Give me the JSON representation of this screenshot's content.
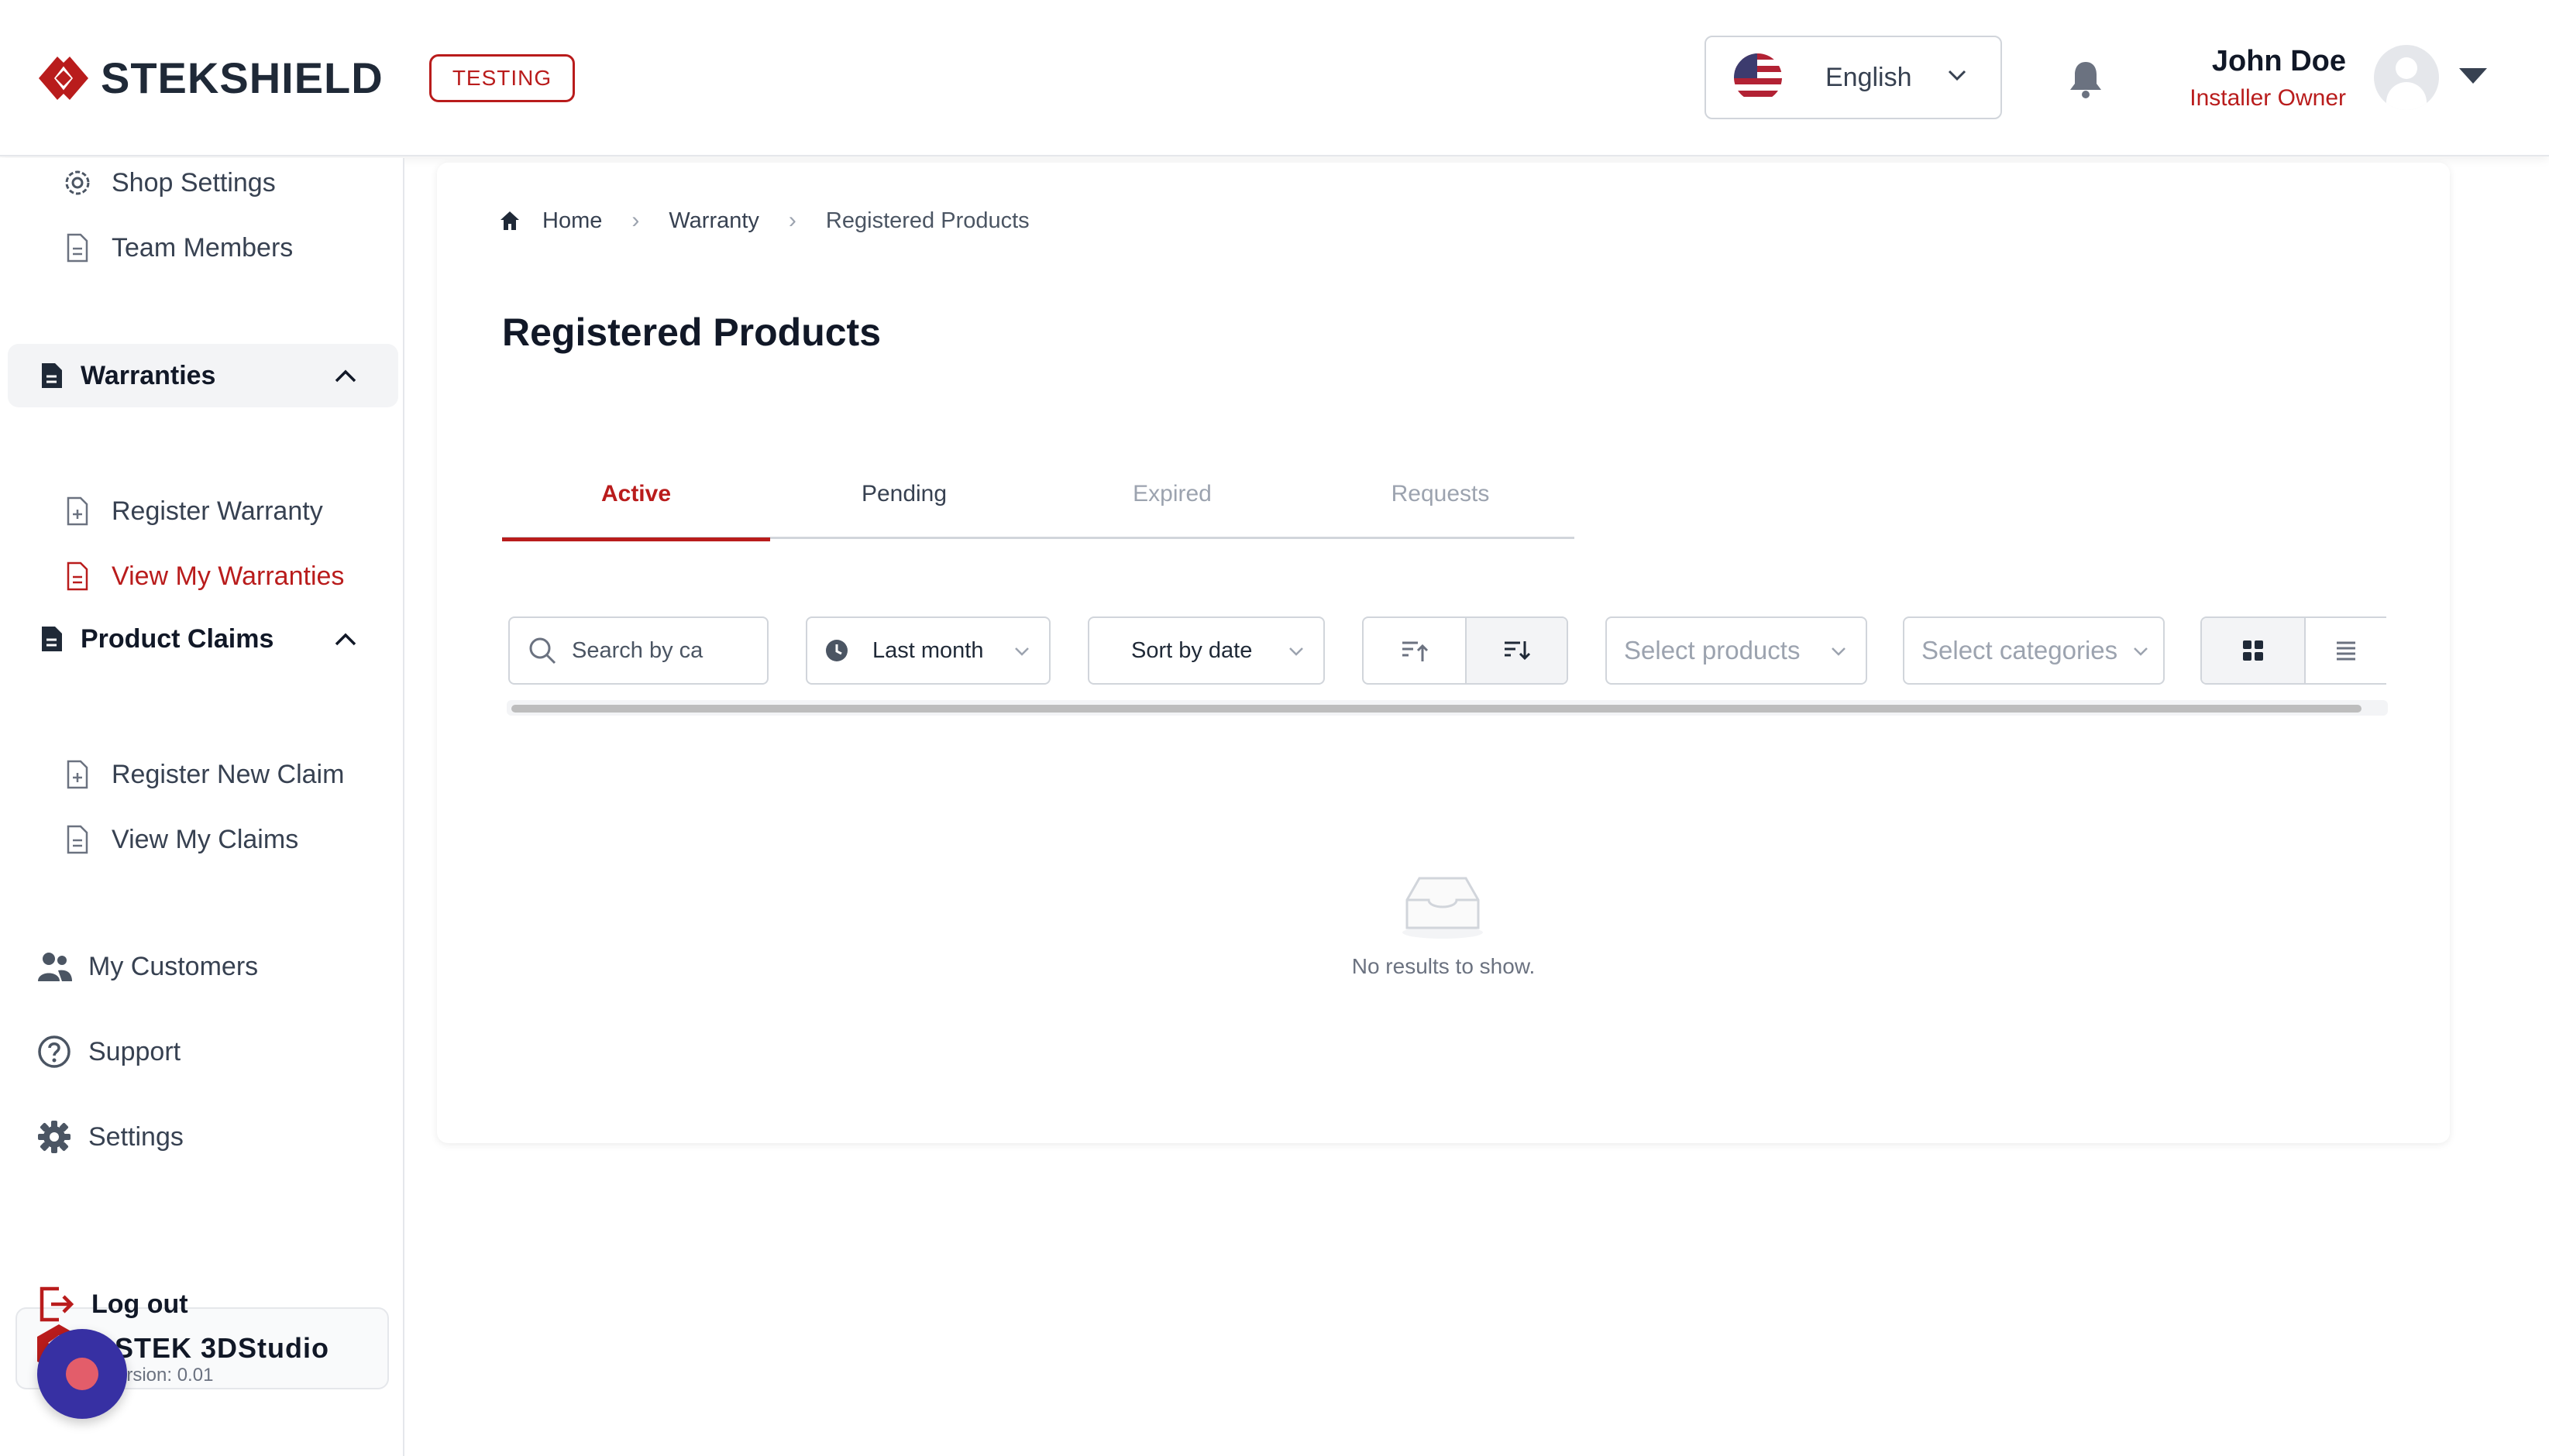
{
  "header": {
    "brand": "STEKSHIELD",
    "env_badge": "TESTING",
    "language": "English",
    "user_name": "John Doe",
    "user_role": "Installer Owner"
  },
  "sidebar": {
    "shop_settings": "Shop Settings",
    "team_members": "Team Members",
    "warranties": {
      "label": "Warranties",
      "items": [
        "Register Warranty",
        "View My Warranties"
      ]
    },
    "product_claims": {
      "label": "Product Claims",
      "items": [
        "Register New Claim",
        "View My Claims"
      ]
    },
    "my_customers": "My Customers",
    "support": "Support",
    "settings": "Settings",
    "studio": "STEK 3DStudio",
    "logout": "Log out",
    "version": "ersion: 0.01"
  },
  "main": {
    "breadcrumb": [
      "Home",
      "Warranty",
      "Registered Products"
    ],
    "title": "Registered Products",
    "tabs": [
      "Active",
      "Pending",
      "Expired",
      "Requests"
    ],
    "filters": {
      "search_value": "Search by ca",
      "period": "Last month",
      "sort": "Sort by date",
      "products_placeholder": "Select products",
      "categories_placeholder": "Select categories"
    },
    "empty_text": "No results to show."
  },
  "colors": {
    "accent": "#b91c1c",
    "fab": "#3730a3"
  }
}
